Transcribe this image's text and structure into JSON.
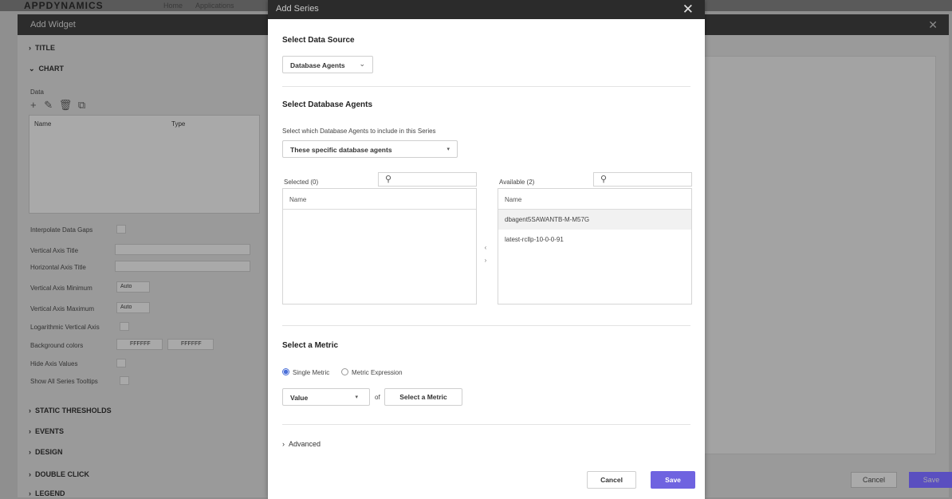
{
  "background_app": {
    "logo": "APPDYNAMICS",
    "nav_tabs": [
      "Home",
      "Applications"
    ],
    "widget_dialog_title": "Add Widget",
    "sections": {
      "title": "TITLE",
      "chart": "CHART",
      "static_thresholds": "STATIC THRESHOLDS",
      "events": "EVENTS",
      "design": "DESIGN",
      "double_click": "DOUBLE CLICK",
      "legend": "LEGEND"
    },
    "data_label": "Data",
    "table_headers": {
      "name": "Name",
      "type": "Type"
    },
    "fields": {
      "interpolate_data_gaps": "Interpolate Data Gaps",
      "vertical_axis_title": "Vertical Axis Title",
      "horizontal_axis_title": "Horizontal Axis Title",
      "vertical_axis_minimum": "Vertical Axis Minimum",
      "vertical_axis_maximum": "Vertical Axis Maximum",
      "logarithmic_vertical_axis": "Logarithmic Vertical Axis",
      "background_colors": "Background colors",
      "hide_axis_values": "Hide Axis Values",
      "show_all_series_tooltips": "Show All Series Tooltips"
    },
    "auto_value": "Auto",
    "color_1": "FFFFFF",
    "color_2": "FFFFFF",
    "cancel": "Cancel",
    "save": "Save"
  },
  "modal": {
    "title": "Add Series",
    "data_source_heading": "Select Data Source",
    "data_source_value": "Database Agents",
    "db_agents_heading": "Select Database Agents",
    "db_agents_help": "Select which Database Agents to include in this Series",
    "agent_scope_value": "These specific database agents",
    "selected_label": "Selected (0)",
    "available_label": "Available (2)",
    "column_name": "Name",
    "available_agents": [
      "dbagent5SAWANTB-M-M57G",
      "latest-rcllp-10-0-0-91"
    ],
    "metric_heading": "Select a Metric",
    "metric_mode_single": "Single Metric",
    "metric_mode_expression": "Metric Expression",
    "value_dropdown": "Value",
    "of_label": "of",
    "select_metric_button": "Select a Metric",
    "advanced_label": "Advanced",
    "cancel_button": "Cancel",
    "save_button": "Save"
  },
  "colors": {
    "modal_header": "#2b2b2b",
    "primary": "#6f63e0",
    "radio_selected": "#4a6fd9"
  }
}
